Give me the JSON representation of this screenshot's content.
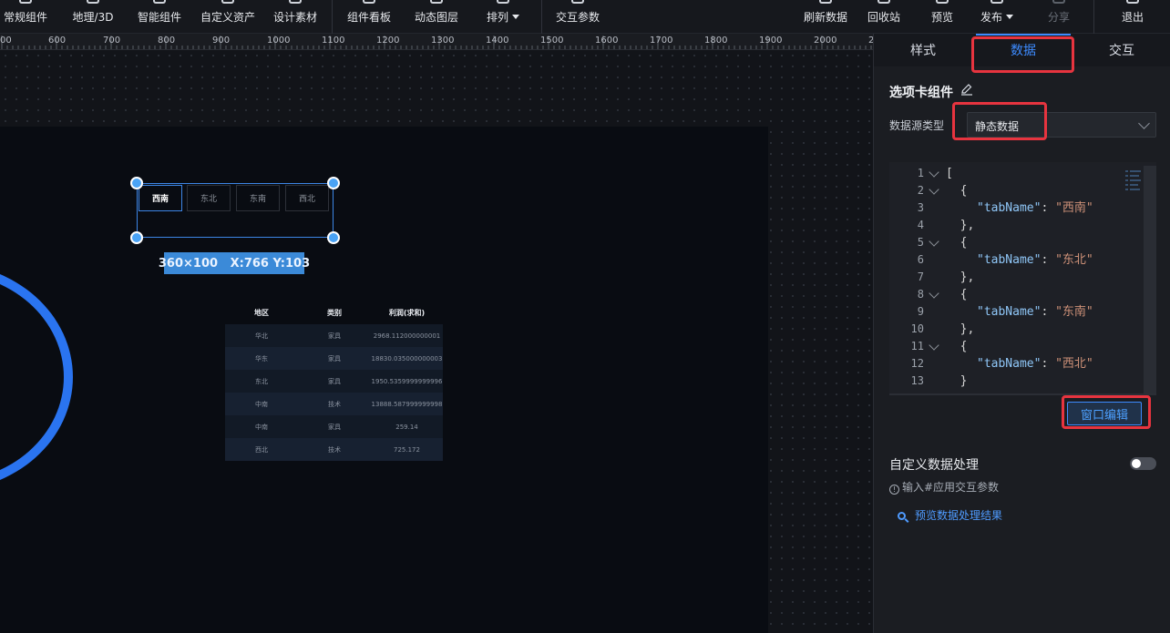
{
  "toolbar": {
    "items": [
      {
        "label": "常规组件"
      },
      {
        "label": "地理/3D"
      },
      {
        "label": "智能组件"
      },
      {
        "label": "自定义资产"
      },
      {
        "label": "设计素材"
      },
      {
        "label": "组件看板"
      },
      {
        "label": "动态图层"
      },
      {
        "label": "排列"
      },
      {
        "label": "交互参数"
      },
      {
        "label": "刷新数据"
      },
      {
        "label": "回收站"
      },
      {
        "label": "预览"
      },
      {
        "label": "发布"
      },
      {
        "label": "分享"
      },
      {
        "label": "退出"
      }
    ]
  },
  "ruler": {
    "labels": [
      "00",
      "600",
      "700",
      "800",
      "900",
      "1000",
      "1100",
      "1200",
      "1300",
      "1400",
      "1500",
      "1600",
      "1700",
      "1800",
      "1900",
      "2000",
      "2"
    ]
  },
  "canvas": {
    "tabs": [
      "西南",
      "东北",
      "东南",
      "西北"
    ],
    "active_tab": "西南",
    "dimension_badge": "360×100   X:766 Y:103",
    "table": {
      "headers": [
        "地区",
        "类别",
        "利润(求和)"
      ],
      "rows": [
        [
          "华北",
          "家具",
          "2968.112000000001"
        ],
        [
          "华东",
          "家具",
          "18830.035000000003"
        ],
        [
          "东北",
          "家具",
          "1950.5359999999996"
        ],
        [
          "中南",
          "技术",
          "13888.587999999998"
        ],
        [
          "中南",
          "家具",
          "259.14"
        ],
        [
          "西北",
          "技术",
          "725.172"
        ]
      ]
    }
  },
  "panel": {
    "tabs": [
      "样式",
      "数据",
      "交互"
    ],
    "active_tab": "数据",
    "component_title": "选项卡组件",
    "data_source_label": "数据源类型",
    "data_source_value": "静态数据",
    "code_lines": [
      {
        "n": "1",
        "fold": true,
        "text": "["
      },
      {
        "n": "2",
        "fold": true,
        "text": "  {"
      },
      {
        "n": "3",
        "fold": false,
        "key": "\"tabName\"",
        "val": "\"西南\""
      },
      {
        "n": "4",
        "fold": false,
        "text": "  },"
      },
      {
        "n": "5",
        "fold": true,
        "text": "  {"
      },
      {
        "n": "6",
        "fold": false,
        "key": "\"tabName\"",
        "val": "\"东北\""
      },
      {
        "n": "7",
        "fold": false,
        "text": "  },"
      },
      {
        "n": "8",
        "fold": true,
        "text": "  {"
      },
      {
        "n": "9",
        "fold": false,
        "key": "\"tabName\"",
        "val": "\"东南\""
      },
      {
        "n": "10",
        "fold": false,
        "text": "  },"
      },
      {
        "n": "11",
        "fold": true,
        "text": "  {"
      },
      {
        "n": "12",
        "fold": false,
        "key": "\"tabName\"",
        "val": "\"西北\""
      },
      {
        "n": "13",
        "fold": false,
        "text": "  }"
      }
    ],
    "window_edit_button": "窗口编辑",
    "custom_processing_label": "自定义数据处理",
    "custom_processing_enabled": false,
    "hint_text": "输入#应用交互参数",
    "preview_link": "预览数据处理结果"
  },
  "colors": {
    "accent": "#3d8bff",
    "highlight_box": "#e7343f",
    "ring": "#2a74f0"
  }
}
